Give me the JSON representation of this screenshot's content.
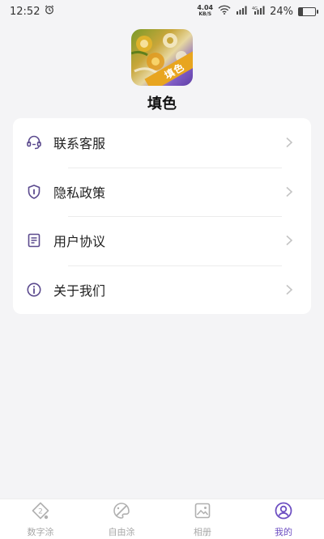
{
  "status_bar": {
    "time": "12:52",
    "net_speed_value": "4.04",
    "net_speed_unit": "KB/S",
    "battery_text": "24%",
    "battery_level": 0.24
  },
  "app": {
    "name": "填色",
    "logo_badge": "填色"
  },
  "menu": {
    "items": [
      {
        "label": "联系客服",
        "icon": "headset-icon"
      },
      {
        "label": "隐私政策",
        "icon": "shield-icon"
      },
      {
        "label": "用户协议",
        "icon": "document-icon"
      },
      {
        "label": "关于我们",
        "icon": "info-icon"
      }
    ]
  },
  "tabs": [
    {
      "label": "数字涂",
      "icon": "number-paint-icon",
      "active": false
    },
    {
      "label": "自由涂",
      "icon": "palette-icon",
      "active": false
    },
    {
      "label": "相册",
      "icon": "album-icon",
      "active": false
    },
    {
      "label": "我的",
      "icon": "profile-icon",
      "active": true
    }
  ],
  "colors": {
    "accent": "#6d4fc2",
    "inactive_tab": "#a8a8a8",
    "icon_purple": "#5b4a8e",
    "background": "#f4f4f6",
    "card": "#ffffff",
    "logo_ribbon": "#e8a51f"
  }
}
